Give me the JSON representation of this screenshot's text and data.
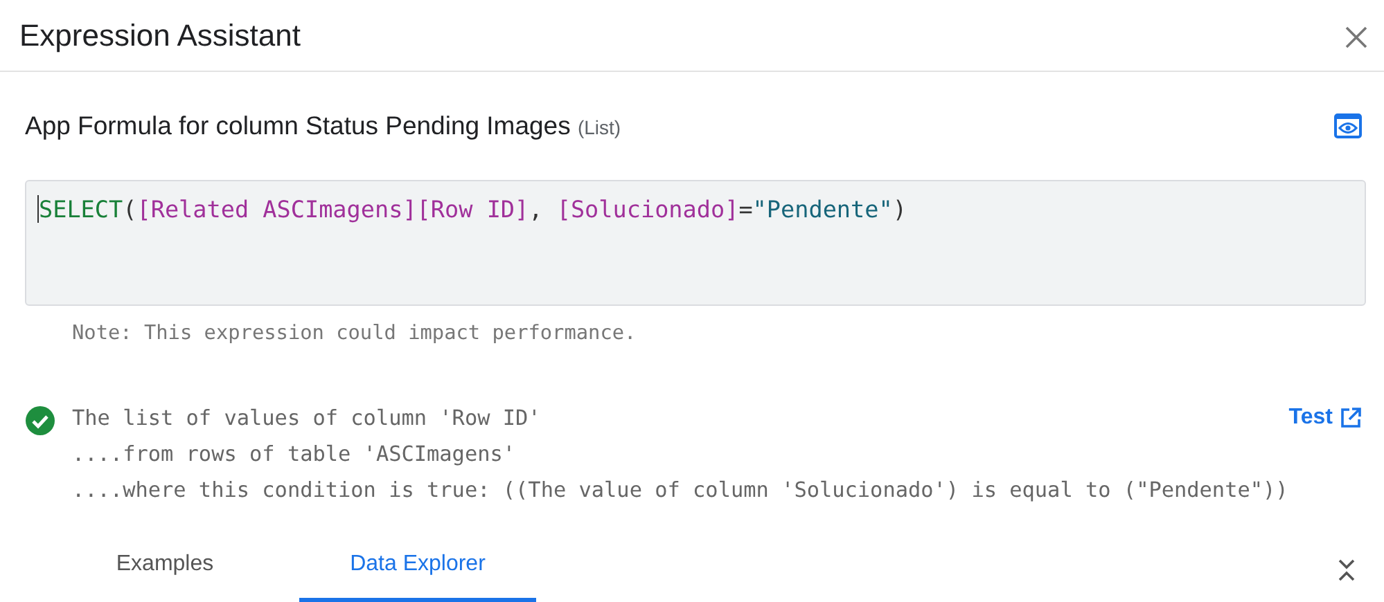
{
  "window": {
    "title": "Expression Assistant"
  },
  "formula": {
    "title": "App Formula for column Status Pending Images",
    "type": "(List)"
  },
  "editor": {
    "tokens": [
      {
        "kind": "function",
        "text": "SELECT"
      },
      {
        "kind": "punct",
        "text": "("
      },
      {
        "kind": "column",
        "text": "[Related ASCImagens][Row ID]"
      },
      {
        "kind": "punct",
        "text": ", "
      },
      {
        "kind": "column",
        "text": "[Solucionado]"
      },
      {
        "kind": "punct",
        "text": "="
      },
      {
        "kind": "string",
        "text": "\"Pendente\""
      },
      {
        "kind": "punct",
        "text": ")"
      }
    ]
  },
  "note": "Note: This expression could impact performance.",
  "result": {
    "valid": true,
    "lines": [
      "The list of values of column 'Row ID'",
      "....from rows of table 'ASCImagens'",
      "....where this condition is true: ((The value of column 'Solucionado') is equal to (\"Pendente\"))"
    ],
    "test_link": "Test"
  },
  "tabs": [
    {
      "label": "Examples",
      "selected": false
    },
    {
      "label": "Data Explorer",
      "selected": true
    }
  ]
}
